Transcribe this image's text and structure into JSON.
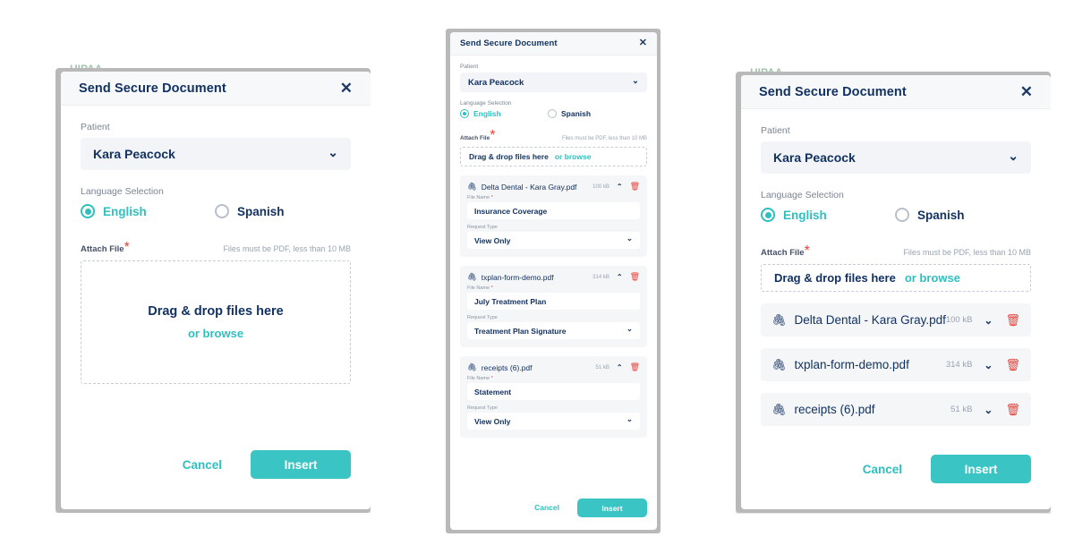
{
  "colors": {
    "accent_teal": "#3bc4c4",
    "title_navy": "#123262",
    "danger_red": "#e8413a",
    "muted_gray": "#9aa3b0",
    "field_bg": "#f2f4f7"
  },
  "background": {
    "hipaa_text": "HIPAA"
  },
  "common": {
    "title": "Send Secure Document",
    "close_icon": "✕",
    "patient_label": "Patient",
    "patient_value": "Kara Peacock",
    "language_label": "Language Selection",
    "option_english": "English",
    "option_spanish": "Spanish",
    "attach_label": "Attach File",
    "required_mark": "*",
    "attach_hint": "Files must be PDF, less than 10 MB",
    "drop_title": "Drag & drop files here",
    "drop_browse": "or browse",
    "cancel_label": "Cancel",
    "insert_label": "Insert",
    "file_name_label": "File Name",
    "request_type_label": "Request Type",
    "clip_icon": "🖇",
    "trash_icon": "🗑",
    "chevron_down": "⌄",
    "chevron_up": "⌃"
  },
  "panel1": {
    "files": []
  },
  "panel2": {
    "files": [
      {
        "name": "Delta Dental - Kara Gray.pdf",
        "size": "100 kB",
        "expanded": true,
        "file_name_value": "Insurance Coverage",
        "request_type_value": "View Only"
      },
      {
        "name": "txplan-form-demo.pdf",
        "size": "314 kB",
        "expanded": true,
        "file_name_value": "July Treatment Plan",
        "request_type_value": "Treatment Plan Signature"
      },
      {
        "name": "receipts (6).pdf",
        "size": "51 kB",
        "expanded": true,
        "file_name_value": "Statement",
        "request_type_value": "View Only"
      }
    ]
  },
  "panel3": {
    "files": [
      {
        "name": "Delta Dental - Kara Gray.pdf",
        "size": "100 kB",
        "expanded": false
      },
      {
        "name": "txplan-form-demo.pdf",
        "size": "314 kB",
        "expanded": false
      },
      {
        "name": "receipts (6).pdf",
        "size": "51 kB",
        "expanded": false
      }
    ]
  }
}
